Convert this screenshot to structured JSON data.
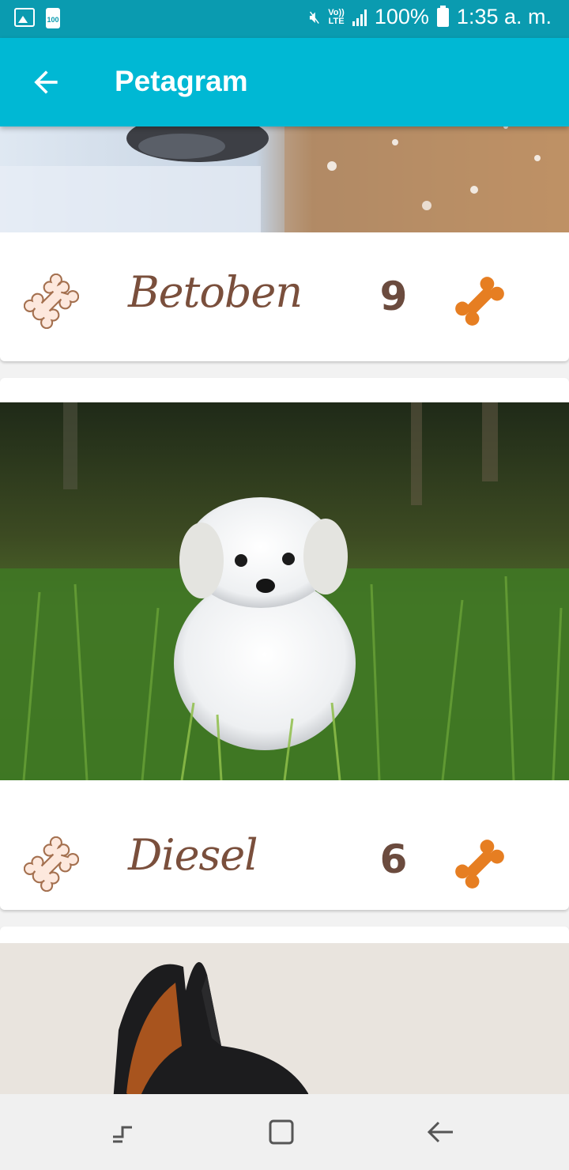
{
  "status_bar": {
    "battery_percent": "100%",
    "time": "1:35 a. m.",
    "volte_top": "Vo))",
    "volte_bottom": "LTE",
    "small_battery_label": "100",
    "icons": [
      "gallery-icon",
      "battery-icon",
      "mute-icon",
      "volte-icon",
      "signal-icon",
      "battery-icon"
    ]
  },
  "app_bar": {
    "title": "Petagram",
    "back_icon": "arrow-back-icon"
  },
  "pets": [
    {
      "name": "Betoben",
      "likes": "9"
    },
    {
      "name": "Diesel",
      "likes": "6"
    }
  ],
  "colors": {
    "app_bar": "#00b8d4",
    "status_bar": "#0a9bb0",
    "bone_filled": "#e67e22",
    "bone_outline_fill": "#fde8dd",
    "bone_outline_stroke": "#a4704f",
    "pet_name": "#7a4f3c"
  },
  "nav_bar": {
    "icons": [
      "recent-apps-icon",
      "home-icon",
      "back-icon"
    ]
  }
}
